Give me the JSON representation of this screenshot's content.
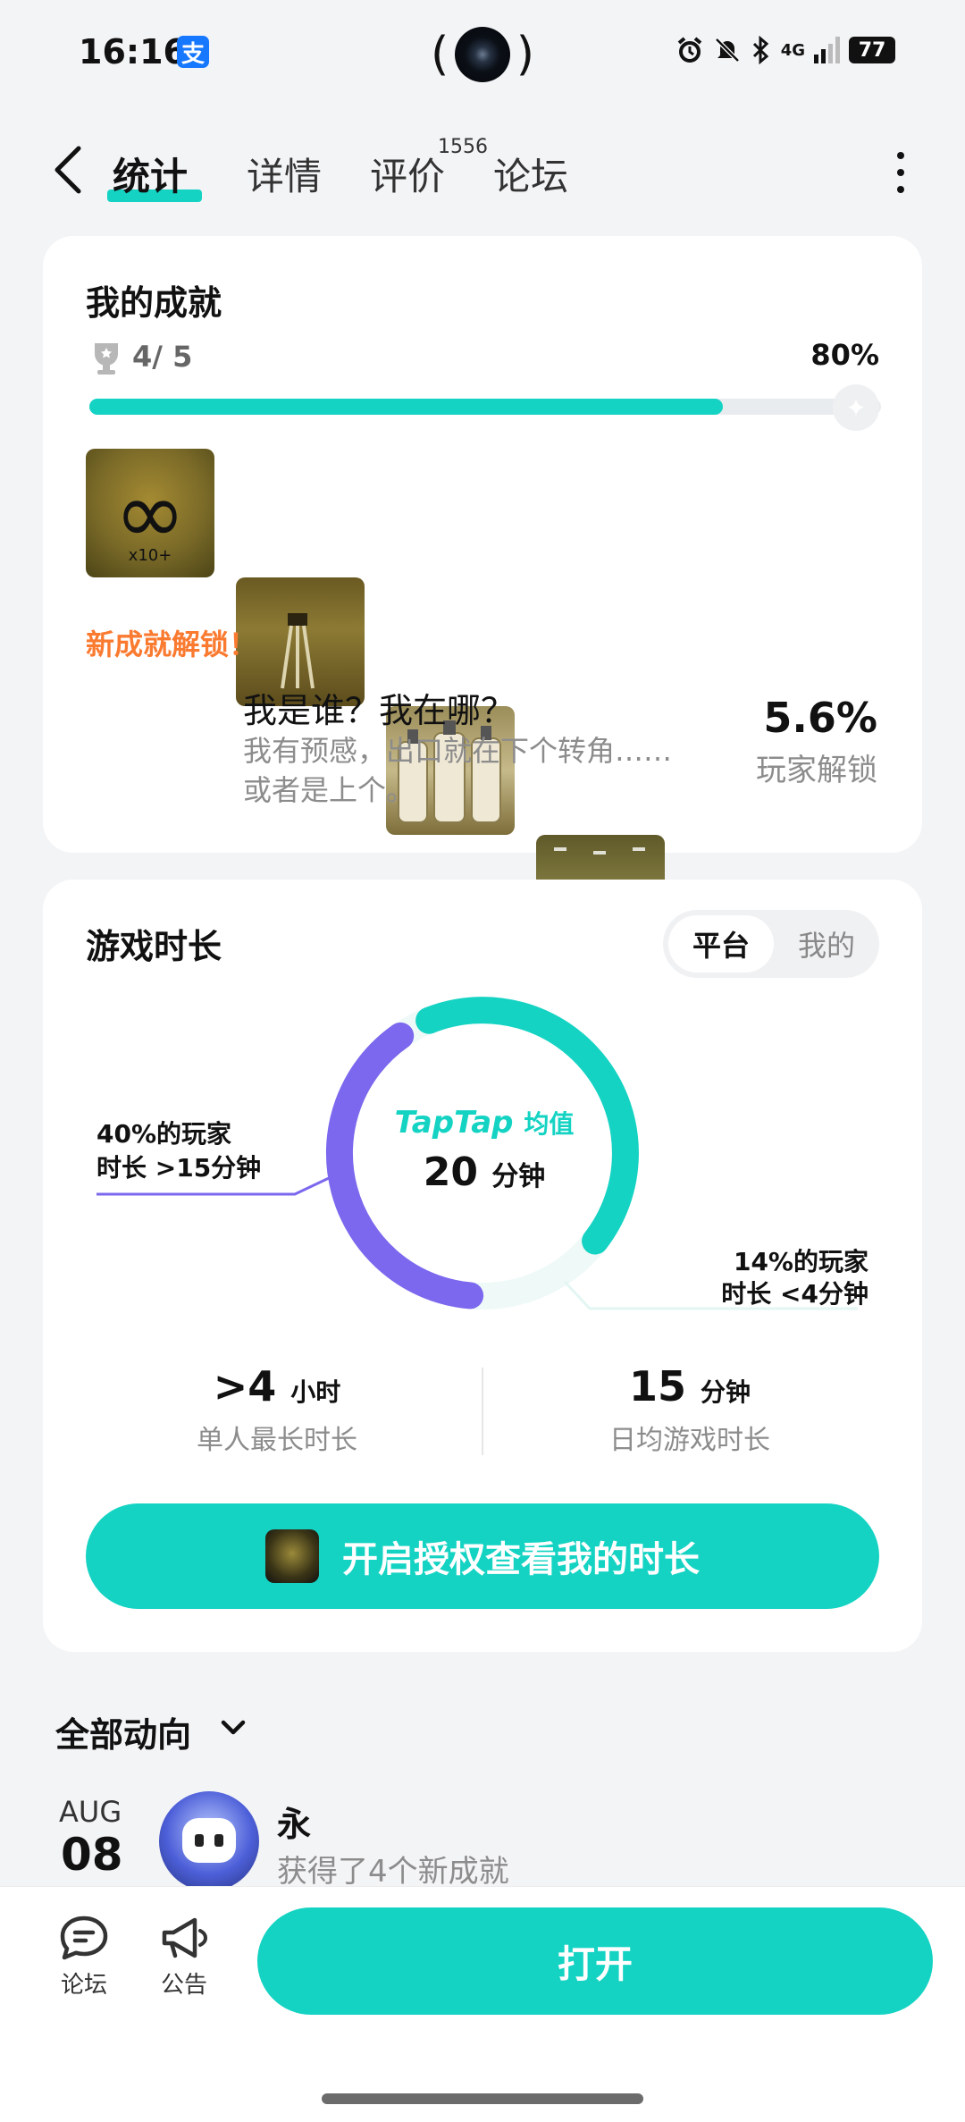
{
  "status_bar": {
    "time": "16:16",
    "alipay_glyph": "支",
    "network": "4G",
    "battery": "77"
  },
  "nav": {
    "tabs": [
      {
        "label": "统计",
        "active": true
      },
      {
        "label": "详情",
        "active": false
      },
      {
        "label": "评价",
        "active": false
      },
      {
        "label": "论坛",
        "active": false
      }
    ],
    "review_count": "1556"
  },
  "achievements": {
    "title": "我的成就",
    "count": "4/ 5",
    "percent_text": "80%",
    "progress": 0.8,
    "new_unlock_label": "新成就解锁！",
    "thumb_badge": "x10+",
    "latest": {
      "name": "我是谁？我在哪？",
      "desc_line1": "我有预感，出口就在下个转角……",
      "desc_line2": "或者是上个。",
      "rate": "5.6%",
      "rate_label": "玩家解锁"
    }
  },
  "playtime": {
    "title": "游戏时长",
    "seg_platform": "平台",
    "seg_mine": "我的",
    "brand": "TapTap",
    "avg_label": "均值",
    "avg_value": "20",
    "avg_unit": "分钟",
    "left_note_line1": "40%的玩家",
    "left_note_line2": "时长 >15分钟",
    "right_note_line1": "14%的玩家",
    "right_note_line2": "时长 <4分钟",
    "distribution": {
      "above_15_min": 0.4,
      "below_4_min": 0.14
    },
    "stats": [
      {
        "value": ">4",
        "unit": "小时",
        "label": "单人最长时长"
      },
      {
        "value": "15",
        "unit": "分钟",
        "label": "日均游戏时长"
      }
    ],
    "auth_button": "开启授权查看我的时长"
  },
  "feed": {
    "title": "全部动向",
    "month": "AUG",
    "day": "08",
    "user": "永",
    "desc": "获得了4个新成就"
  },
  "bottom_bar": {
    "forum_label": "论坛",
    "notice_label": "公告",
    "open_button": "打开"
  },
  "colors": {
    "accent": "#14d3c3",
    "purple": "#7b68ee",
    "orange": "#fa7a30"
  }
}
